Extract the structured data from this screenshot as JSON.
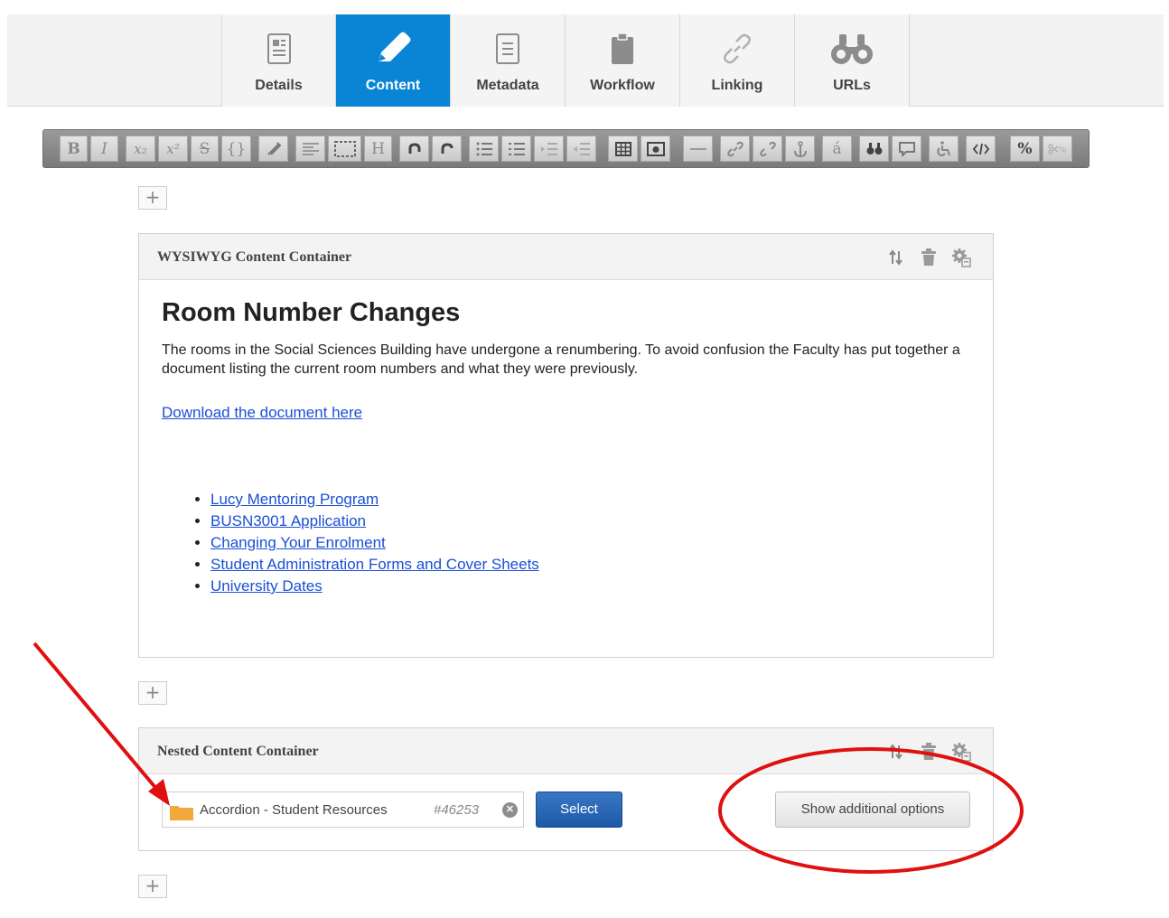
{
  "tabs": [
    {
      "label": "Details",
      "icon": "details-icon",
      "active": false
    },
    {
      "label": "Content",
      "icon": "pencil-icon",
      "active": true
    },
    {
      "label": "Metadata",
      "icon": "metadata-icon",
      "active": false
    },
    {
      "label": "Workflow",
      "icon": "clipboard-icon",
      "active": false
    },
    {
      "label": "Linking",
      "icon": "link-icon",
      "active": false
    },
    {
      "label": "URLs",
      "icon": "binoculars-icon",
      "active": false
    }
  ],
  "toolbar": {
    "bold": "B",
    "italic": "I",
    "subscript": "x₂",
    "superscript": "x²",
    "strike": "S",
    "braces": "{}",
    "heading": "H",
    "accent": "á",
    "percent": "%"
  },
  "add_button_label": "+",
  "wysiwyg": {
    "title": "WYSIWYG Content Container",
    "heading": "Room Number Changes",
    "paragraph": "The rooms in the Social Sciences Building have undergone a renumbering. To avoid confusion the Faculty has put together a document listing the current room numbers and what they were previously.",
    "download_link": "Download the document here",
    "links": [
      "Lucy Mentoring Program",
      "BUSN3001 Application",
      "Changing Your Enrolment",
      "Student Administration Forms and Cover Sheets",
      "University Dates"
    ]
  },
  "nested": {
    "title": "Nested Content Container",
    "asset_name": "Accordion - Student Resources",
    "asset_id": "#46253",
    "select_label": "Select",
    "more_label": "Show additional options"
  },
  "colors": {
    "active_tab": "#0a84d4",
    "link": "#1a4fd6",
    "annotation": "#e01010",
    "select_button": "#1d5aa7"
  }
}
